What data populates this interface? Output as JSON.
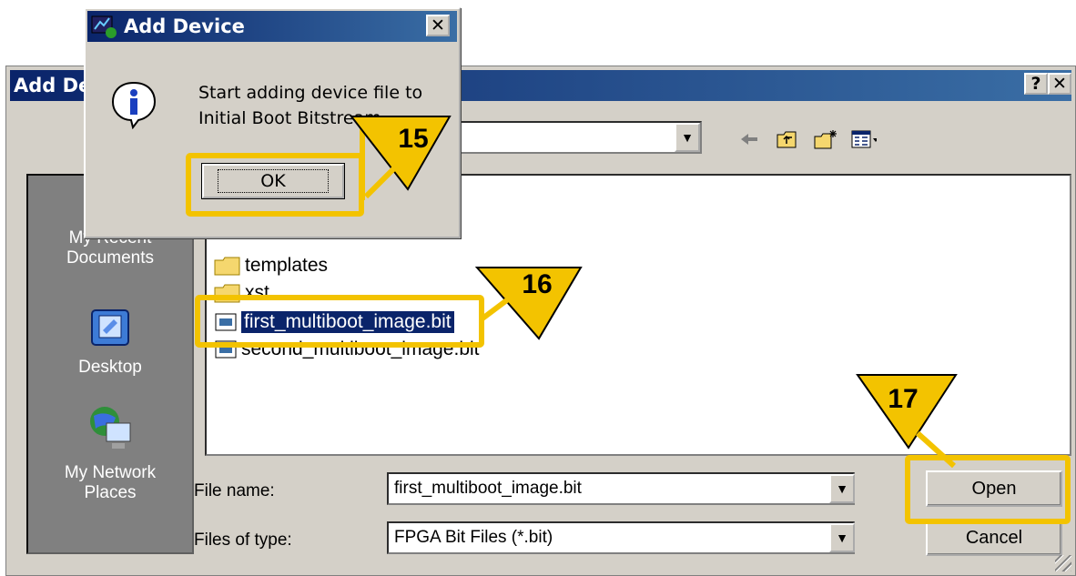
{
  "main_dialog": {
    "title": "Add Device",
    "help_label": "?",
    "close_label": "✕"
  },
  "places": [
    {
      "label_lines": [
        "My Recent",
        "Documents"
      ],
      "icon": "recent-documents-icon"
    },
    {
      "label_lines": [
        "Desktop"
      ],
      "icon": "desktop-icon"
    },
    {
      "label_lines": [
        "My Network",
        "Places"
      ],
      "icon": "network-places-icon"
    }
  ],
  "files": [
    {
      "name": "templates",
      "type": "folder"
    },
    {
      "name": "xst",
      "type": "folder"
    },
    {
      "name": "first_multiboot_image.bit",
      "type": "bit",
      "selected": true
    },
    {
      "name": "second_multiboot_image.bit",
      "type": "bit"
    }
  ],
  "form": {
    "file_name_label": "File name:",
    "file_name_value": "first_multiboot_image.bit",
    "files_of_type_label": "Files of type:",
    "files_of_type_value": "FPGA Bit Files (*.bit)"
  },
  "buttons": {
    "open": "Open",
    "cancel": "Cancel"
  },
  "message_box": {
    "title": "Add Device",
    "line1": "Start adding device file to",
    "line2": "Initial Boot Bitstream",
    "ok_label": "OK",
    "icon": "info-icon"
  },
  "callouts": {
    "c15": "15",
    "c16": "16",
    "c17": "17"
  },
  "colors": {
    "titlebar": "#0a246a",
    "highlight": "#f3c300",
    "dialog_bg": "#d4d0c8"
  }
}
